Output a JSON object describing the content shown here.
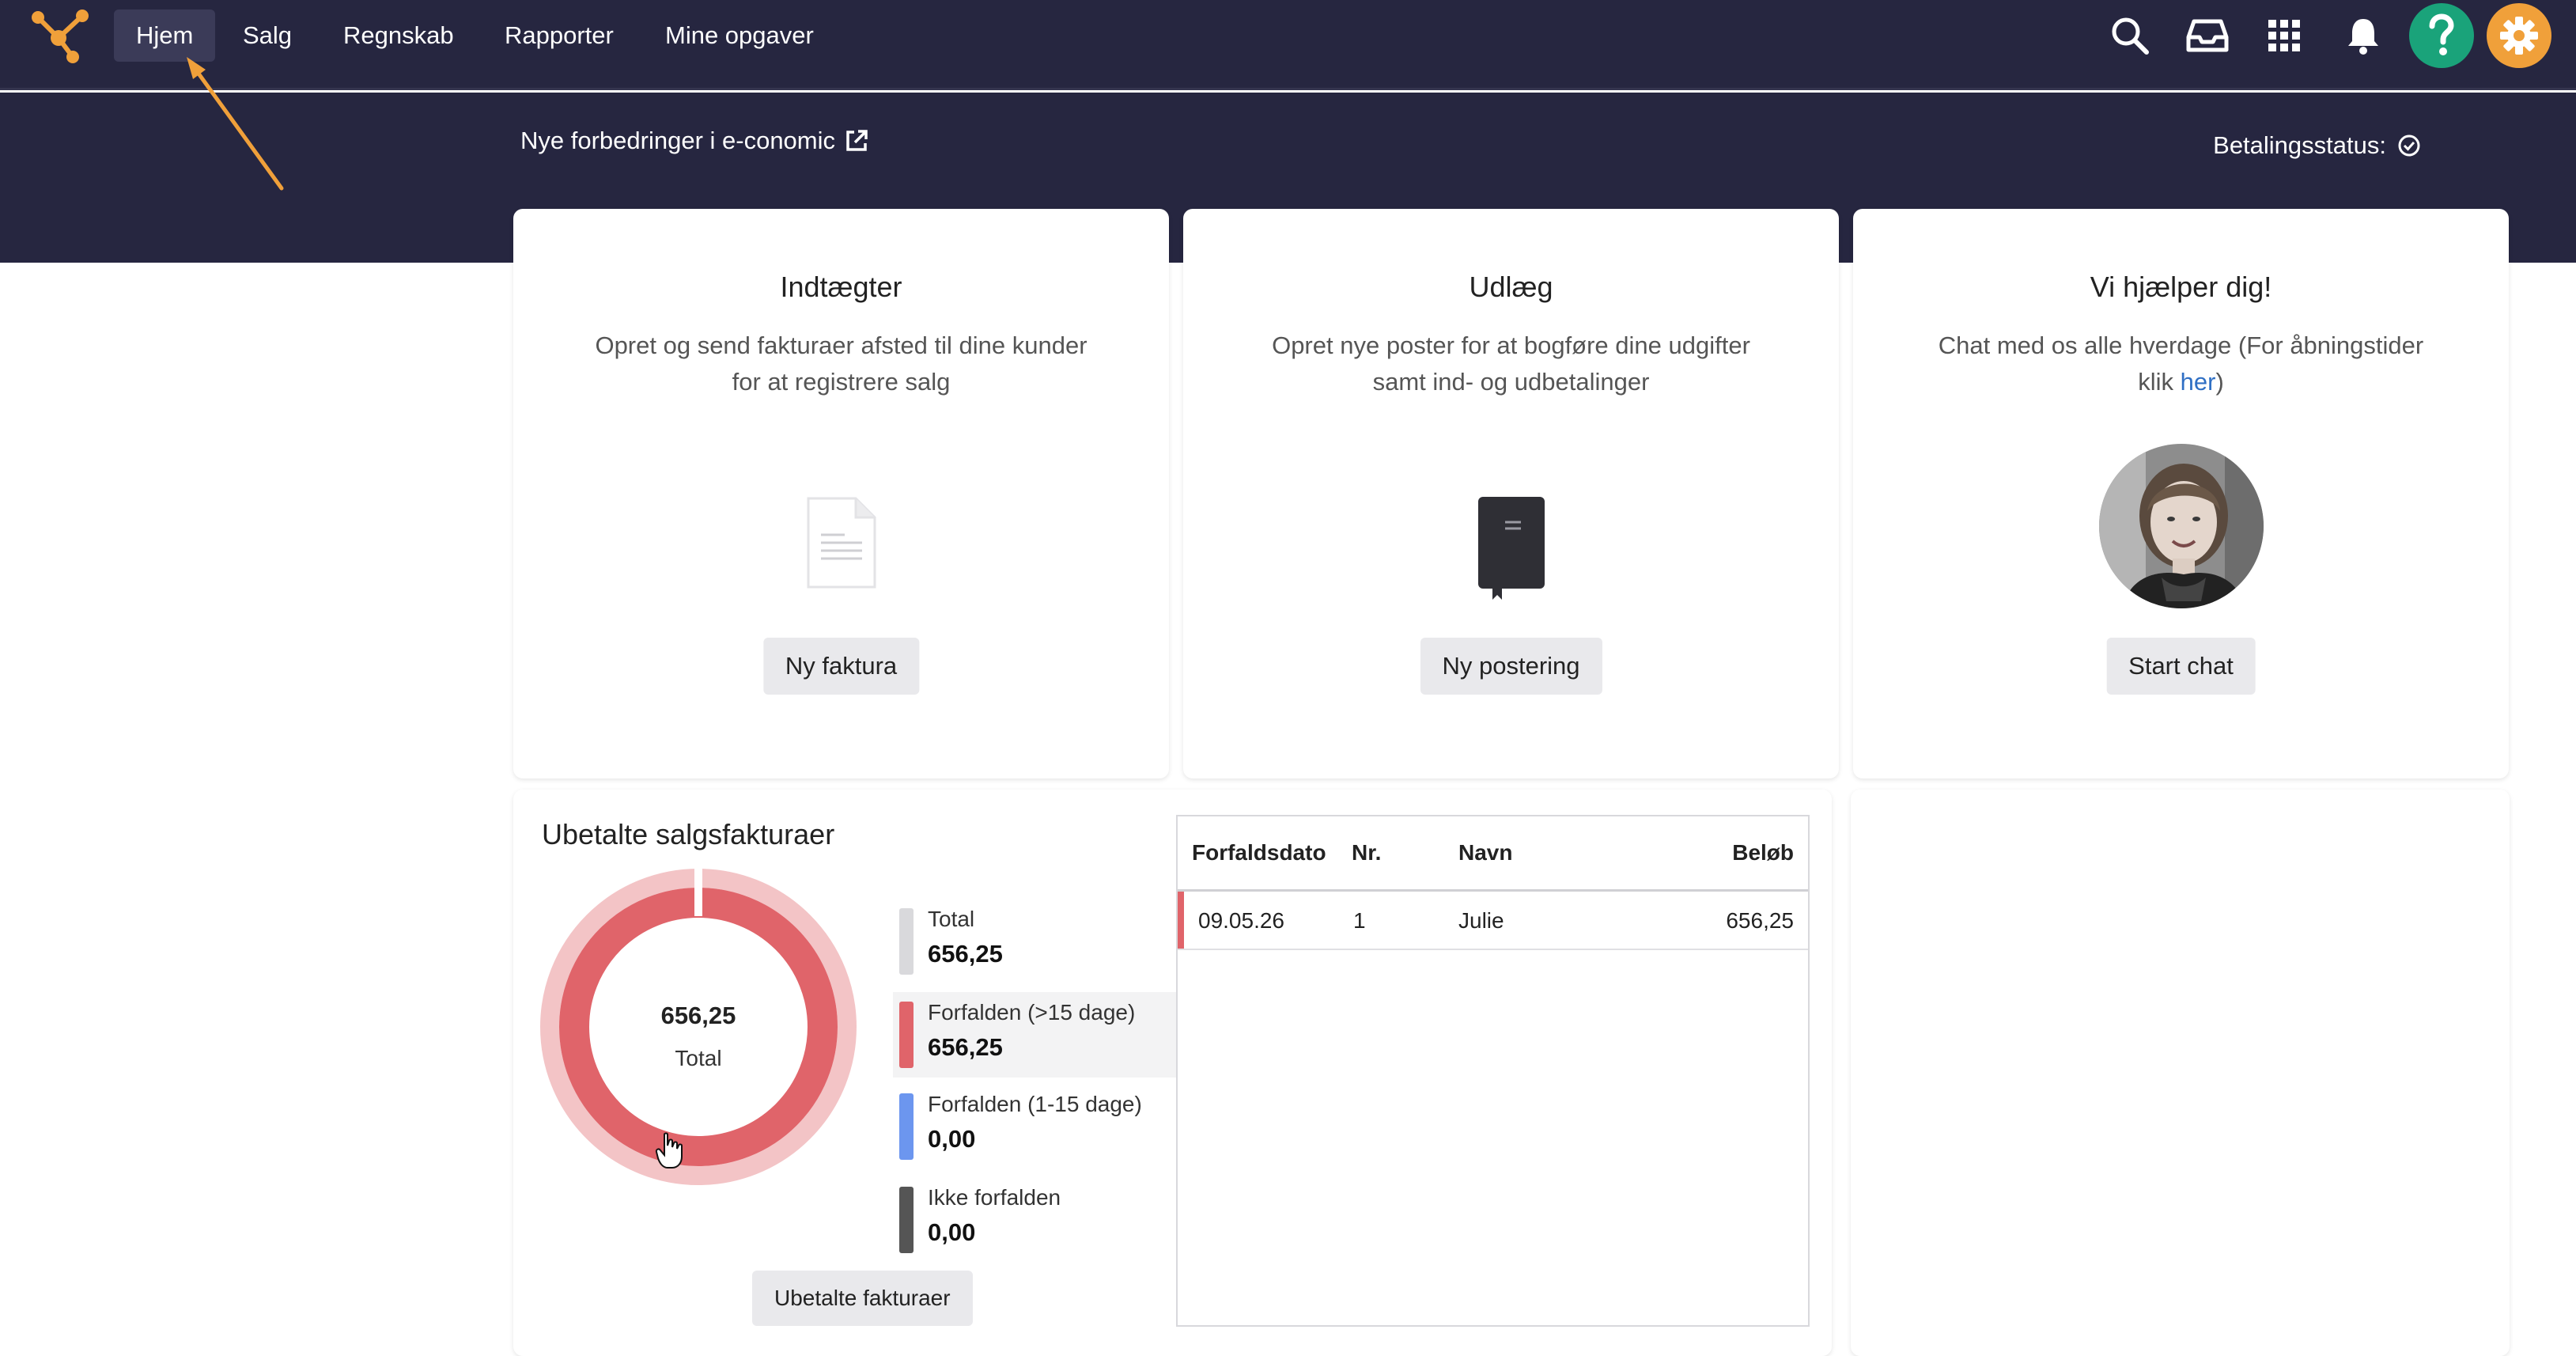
{
  "nav": {
    "items": [
      {
        "label": "Hjem",
        "active": true
      },
      {
        "label": "Salg",
        "active": false
      },
      {
        "label": "Regnskab",
        "active": false
      },
      {
        "label": "Rapporter",
        "active": false
      },
      {
        "label": "Mine opgaver",
        "active": false
      }
    ],
    "icons": [
      "search-icon",
      "inbox-icon",
      "apps-grid-icon",
      "bell-icon",
      "help-icon",
      "settings-icon"
    ],
    "colors": {
      "bg": "#262640",
      "help": "#1aa37a",
      "settings": "#f0a03a",
      "logo": "#f0a03a"
    }
  },
  "header": {
    "news_link": "Nye forbedringer i e-conomic",
    "payment_status": "Betalingsstatus:"
  },
  "cards": {
    "income": {
      "title": "Indtægter",
      "desc": "Opret og send fakturaer afsted til dine kunder for at registrere salg",
      "button": "Ny faktura"
    },
    "expenses": {
      "title": "Udlæg",
      "desc": "Opret nye poster for at bogføre dine udgifter samt ind- og udbetalinger",
      "button": "Ny postering"
    },
    "help": {
      "title": "Vi hjælper dig!",
      "desc_pre": "Chat med os alle hverdage (For åbningstider klik ",
      "desc_link": "her",
      "desc_post": ")",
      "button": "Start chat"
    }
  },
  "unpaid": {
    "title": "Ubetalte salgsfakturaer",
    "center_value": "656,25",
    "center_label": "Total",
    "legend": [
      {
        "label": "Total",
        "value": "656,25",
        "color": "#d9d9dc"
      },
      {
        "label": "Forfalden (>15 dage)",
        "value": "656,25",
        "color": "#e0646a"
      },
      {
        "label": "Forfalden (1-15 dage)",
        "value": "0,00",
        "color": "#6c96ef"
      },
      {
        "label": "Ikke forfalden",
        "value": "0,00",
        "color": "#555555"
      }
    ],
    "button": "Ubetalte fakturaer"
  },
  "table": {
    "headers": {
      "due": "Forfaldsdato",
      "nr": "Nr.",
      "name": "Navn",
      "amount": "Beløb"
    },
    "rows": [
      {
        "due": "09.05.26",
        "nr": "1",
        "name": "Julie",
        "amount": "656,25"
      }
    ]
  }
}
